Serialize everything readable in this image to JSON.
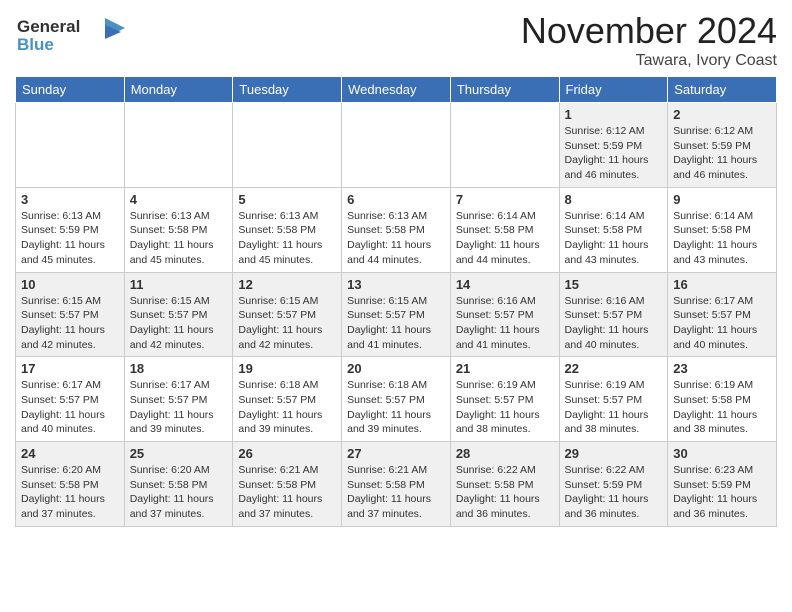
{
  "header": {
    "logo_line1": "General",
    "logo_line2": "Blue",
    "month": "November 2024",
    "location": "Tawara, Ivory Coast"
  },
  "days_of_week": [
    "Sunday",
    "Monday",
    "Tuesday",
    "Wednesday",
    "Thursday",
    "Friday",
    "Saturday"
  ],
  "weeks": [
    [
      {
        "day": "",
        "info": ""
      },
      {
        "day": "",
        "info": ""
      },
      {
        "day": "",
        "info": ""
      },
      {
        "day": "",
        "info": ""
      },
      {
        "day": "",
        "info": ""
      },
      {
        "day": "1",
        "info": "Sunrise: 6:12 AM\nSunset: 5:59 PM\nDaylight: 11 hours\nand 46 minutes."
      },
      {
        "day": "2",
        "info": "Sunrise: 6:12 AM\nSunset: 5:59 PM\nDaylight: 11 hours\nand 46 minutes."
      }
    ],
    [
      {
        "day": "3",
        "info": "Sunrise: 6:13 AM\nSunset: 5:59 PM\nDaylight: 11 hours\nand 45 minutes."
      },
      {
        "day": "4",
        "info": "Sunrise: 6:13 AM\nSunset: 5:58 PM\nDaylight: 11 hours\nand 45 minutes."
      },
      {
        "day": "5",
        "info": "Sunrise: 6:13 AM\nSunset: 5:58 PM\nDaylight: 11 hours\nand 45 minutes."
      },
      {
        "day": "6",
        "info": "Sunrise: 6:13 AM\nSunset: 5:58 PM\nDaylight: 11 hours\nand 44 minutes."
      },
      {
        "day": "7",
        "info": "Sunrise: 6:14 AM\nSunset: 5:58 PM\nDaylight: 11 hours\nand 44 minutes."
      },
      {
        "day": "8",
        "info": "Sunrise: 6:14 AM\nSunset: 5:58 PM\nDaylight: 11 hours\nand 43 minutes."
      },
      {
        "day": "9",
        "info": "Sunrise: 6:14 AM\nSunset: 5:58 PM\nDaylight: 11 hours\nand 43 minutes."
      }
    ],
    [
      {
        "day": "10",
        "info": "Sunrise: 6:15 AM\nSunset: 5:57 PM\nDaylight: 11 hours\nand 42 minutes."
      },
      {
        "day": "11",
        "info": "Sunrise: 6:15 AM\nSunset: 5:57 PM\nDaylight: 11 hours\nand 42 minutes."
      },
      {
        "day": "12",
        "info": "Sunrise: 6:15 AM\nSunset: 5:57 PM\nDaylight: 11 hours\nand 42 minutes."
      },
      {
        "day": "13",
        "info": "Sunrise: 6:15 AM\nSunset: 5:57 PM\nDaylight: 11 hours\nand 41 minutes."
      },
      {
        "day": "14",
        "info": "Sunrise: 6:16 AM\nSunset: 5:57 PM\nDaylight: 11 hours\nand 41 minutes."
      },
      {
        "day": "15",
        "info": "Sunrise: 6:16 AM\nSunset: 5:57 PM\nDaylight: 11 hours\nand 40 minutes."
      },
      {
        "day": "16",
        "info": "Sunrise: 6:17 AM\nSunset: 5:57 PM\nDaylight: 11 hours\nand 40 minutes."
      }
    ],
    [
      {
        "day": "17",
        "info": "Sunrise: 6:17 AM\nSunset: 5:57 PM\nDaylight: 11 hours\nand 40 minutes."
      },
      {
        "day": "18",
        "info": "Sunrise: 6:17 AM\nSunset: 5:57 PM\nDaylight: 11 hours\nand 39 minutes."
      },
      {
        "day": "19",
        "info": "Sunrise: 6:18 AM\nSunset: 5:57 PM\nDaylight: 11 hours\nand 39 minutes."
      },
      {
        "day": "20",
        "info": "Sunrise: 6:18 AM\nSunset: 5:57 PM\nDaylight: 11 hours\nand 39 minutes."
      },
      {
        "day": "21",
        "info": "Sunrise: 6:19 AM\nSunset: 5:57 PM\nDaylight: 11 hours\nand 38 minutes."
      },
      {
        "day": "22",
        "info": "Sunrise: 6:19 AM\nSunset: 5:57 PM\nDaylight: 11 hours\nand 38 minutes."
      },
      {
        "day": "23",
        "info": "Sunrise: 6:19 AM\nSunset: 5:58 PM\nDaylight: 11 hours\nand 38 minutes."
      }
    ],
    [
      {
        "day": "24",
        "info": "Sunrise: 6:20 AM\nSunset: 5:58 PM\nDaylight: 11 hours\nand 37 minutes."
      },
      {
        "day": "25",
        "info": "Sunrise: 6:20 AM\nSunset: 5:58 PM\nDaylight: 11 hours\nand 37 minutes."
      },
      {
        "day": "26",
        "info": "Sunrise: 6:21 AM\nSunset: 5:58 PM\nDaylight: 11 hours\nand 37 minutes."
      },
      {
        "day": "27",
        "info": "Sunrise: 6:21 AM\nSunset: 5:58 PM\nDaylight: 11 hours\nand 37 minutes."
      },
      {
        "day": "28",
        "info": "Sunrise: 6:22 AM\nSunset: 5:58 PM\nDaylight: 11 hours\nand 36 minutes."
      },
      {
        "day": "29",
        "info": "Sunrise: 6:22 AM\nSunset: 5:59 PM\nDaylight: 11 hours\nand 36 minutes."
      },
      {
        "day": "30",
        "info": "Sunrise: 6:23 AM\nSunset: 5:59 PM\nDaylight: 11 hours\nand 36 minutes."
      }
    ]
  ]
}
